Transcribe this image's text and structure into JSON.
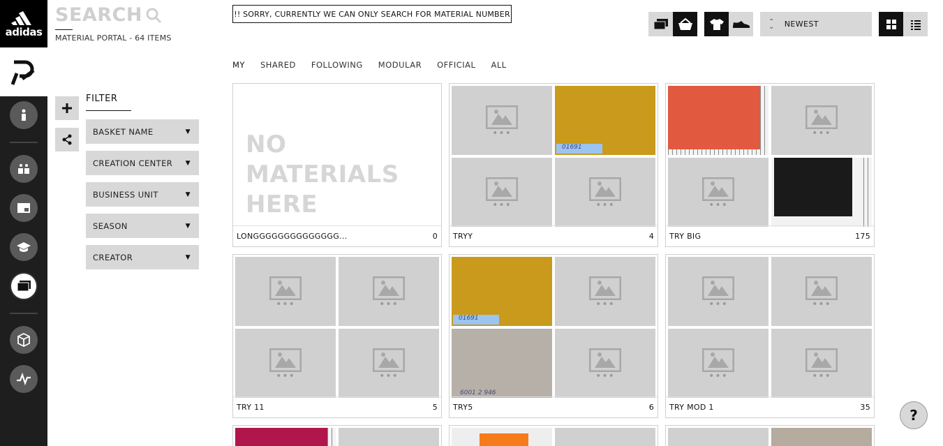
{
  "brand": {
    "name": "adidas"
  },
  "header": {
    "search_title": "SEARCH",
    "subtitle": "MATERIAL PORTAL - 64 ITEMS",
    "notice": "!! SORRY, CURRENTLY WE CAN ONLY SEARCH FOR MATERIAL NUMBER",
    "sort_label": "NEWEST"
  },
  "tabs": [
    "MY",
    "SHARED",
    "FOLLOWING",
    "MODULAR",
    "OFFICIAL",
    "ALL"
  ],
  "filter": {
    "title": "FILTER",
    "dropdowns": [
      "BASKET NAME",
      "CREATION CENTER",
      "BUSINESS UNIT",
      "SEASON",
      "CREATOR"
    ]
  },
  "cards": [
    {
      "name": "LONGGGGGGGGGGGGGG...",
      "count": "0",
      "empty_text_1": "NO MATERIALS",
      "empty_text_2": "HERE"
    },
    {
      "name": "TRYY",
      "count": "4"
    },
    {
      "name": "TRY BIG",
      "count": "175"
    },
    {
      "name": "TRY 11",
      "count": "5"
    },
    {
      "name": "TRY5",
      "count": "6"
    },
    {
      "name": "TRY MOD 1",
      "count": "35"
    }
  ],
  "sample_labels": {
    "a": "01691",
    "b": "01691",
    "c": "6001 2 946"
  },
  "help": "?",
  "colors": {
    "rail": "#1e1e1e",
    "tile": "#d0d0d0",
    "button": "#d8d8d8",
    "mustard": "#c99a1c"
  }
}
